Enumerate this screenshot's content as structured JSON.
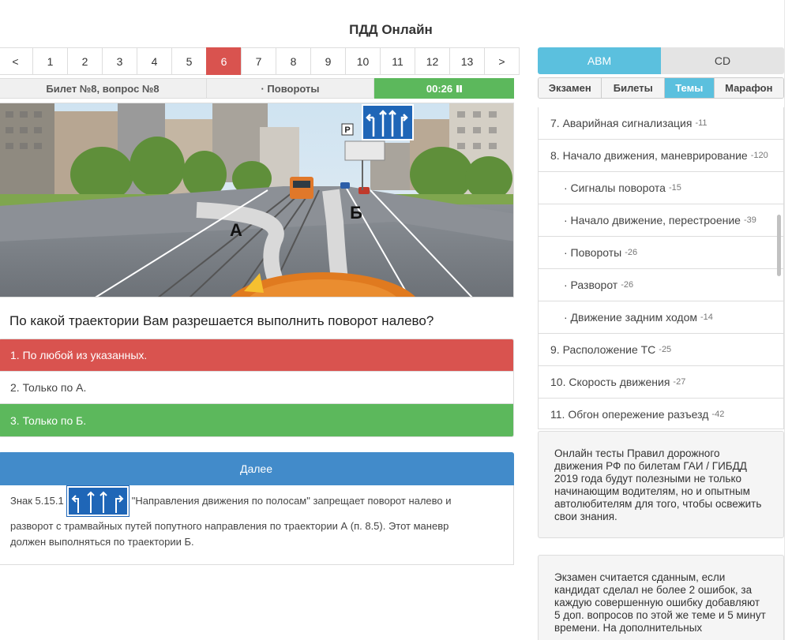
{
  "page_title": "ПДД Онлайн",
  "pagination": {
    "prev": "<",
    "next": ">",
    "pages": [
      "1",
      "2",
      "3",
      "4",
      "5",
      "6",
      "7",
      "8",
      "9",
      "10",
      "11",
      "12",
      "13"
    ],
    "active_page": "6"
  },
  "info": {
    "ticket": "Билет №8, вопрос №8",
    "topic": "· Повороты",
    "timer": "00:26"
  },
  "scene": {
    "label_a": "А",
    "label_b": "Б",
    "parking_letter": "P"
  },
  "question": "По какой траектории Вам разрешается выполнить поворот налево?",
  "answers": [
    {
      "text": "1. По любой из указанных.",
      "state": "wrong"
    },
    {
      "text": "2. Только по А.",
      "state": "neutral"
    },
    {
      "text": "3. Только по Б.",
      "state": "right"
    }
  ],
  "next_button": "Далее",
  "explanation": {
    "prefix": "Знак 5.15.1",
    "line1": "\"Направления движения по полосам\" запрещает поворот налево и",
    "line2": "разворот с трамвайных путей попутного направления по траектории А (п. 8.5). Этот маневр",
    "line3": "должен выполняться по траектории Б."
  },
  "categories": {
    "abm": "ABM",
    "cd": "CD"
  },
  "sub_tabs": [
    "Экзамен",
    "Билеты",
    "Темы",
    "Марафон"
  ],
  "active_sub_tab": "Темы",
  "topics": [
    {
      "label": "7. Аварийная сигнализация",
      "count": "-11",
      "sub": false
    },
    {
      "label": "8. Начало движения, маневрирование",
      "count": "-120",
      "sub": false
    },
    {
      "label": "· Сигналы поворота",
      "count": "-15",
      "sub": true
    },
    {
      "label": "· Начало движение, перестроение",
      "count": "-39",
      "sub": true
    },
    {
      "label": "· Повороты",
      "count": "-26",
      "sub": true
    },
    {
      "label": "· Разворот",
      "count": "-26",
      "sub": true
    },
    {
      "label": "· Движение задним ходом",
      "count": "-14",
      "sub": true
    },
    {
      "label": "9. Расположение ТС",
      "count": "-25",
      "sub": false
    },
    {
      "label": "10. Скорость движения",
      "count": "-27",
      "sub": false
    },
    {
      "label": "11. Обгон опережение разъезд",
      "count": "-42",
      "sub": false
    }
  ],
  "info_card_1": "Онлайн тесты Правил дорожного движения РФ по билетам ГАИ / ГИБДД 2019 года будут полезными не только начинающим водителям, но и опытным автолюбителям для того, чтобы освежить свои знания.",
  "info_card_2": "Экзамен считается сданным, если кандидат сделал не более 2 ошибок, за каждую совершенную ошибку добавляют 5 доп. вопросов по этой же теме и 5 минут времени. На дополнительных",
  "colors": {
    "active_red": "#d9534f",
    "success_green": "#5cb85c",
    "primary_blue": "#428bca",
    "info_cyan": "#5bc0de"
  }
}
